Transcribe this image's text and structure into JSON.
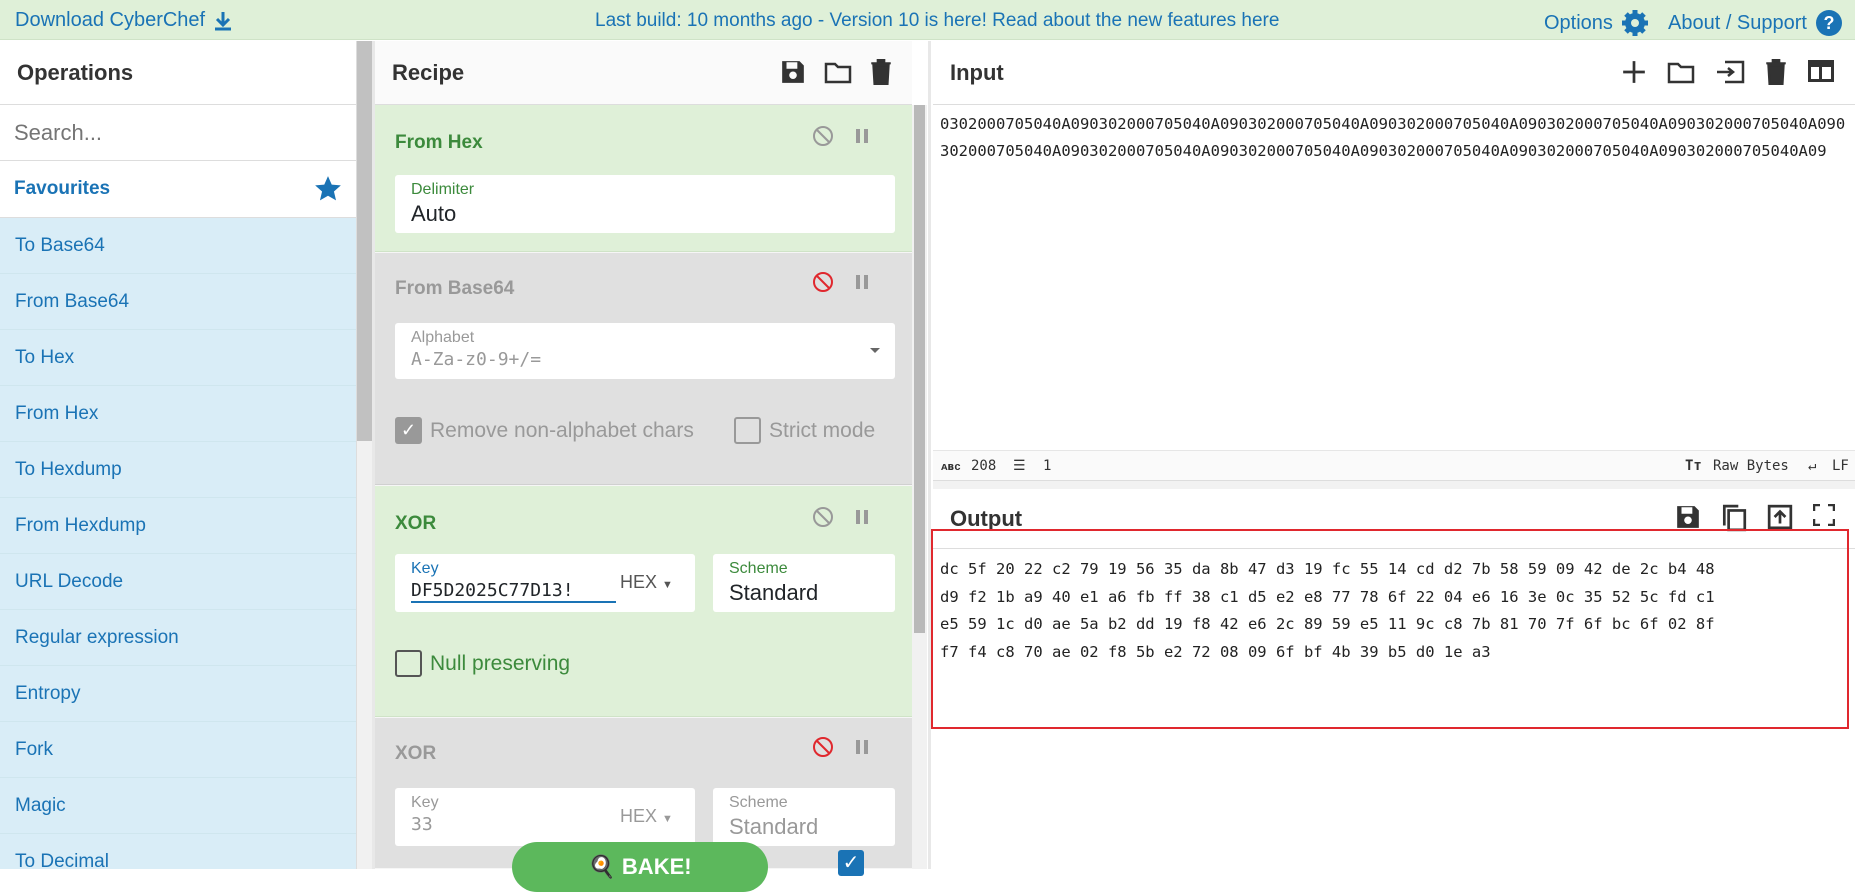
{
  "topbar": {
    "download_label": "Download CyberChef",
    "banner": "Last build: 10 months ago - Version 10 is here! Read about the new features here",
    "options_label": "Options",
    "about_label": "About / Support"
  },
  "operations": {
    "title": "Operations",
    "search_placeholder": "Search...",
    "favourites_label": "Favourites",
    "items": [
      "To Base64",
      "From Base64",
      "To Hex",
      "From Hex",
      "To Hexdump",
      "From Hexdump",
      "URL Decode",
      "Regular expression",
      "Entropy",
      "Fork",
      "Magic",
      "To Decimal"
    ]
  },
  "recipe": {
    "title": "Recipe",
    "ops": [
      {
        "name": "From Hex",
        "field_label": "Delimiter",
        "field_value": "Auto"
      },
      {
        "name": "From Base64",
        "field_label": "Alphabet",
        "field_value": "A-Za-z0-9+/=",
        "check1": "Remove non-alphabet chars",
        "check2": "Strict mode"
      },
      {
        "name": "XOR",
        "key_label": "Key",
        "key_value": "DF5D2025C77D13!",
        "key_type": "HEX",
        "scheme_label": "Scheme",
        "scheme_value": "Standard",
        "check1": "Null preserving"
      },
      {
        "name": "XOR",
        "key_label": "Key",
        "key_value": "33",
        "key_type": "HEX",
        "scheme_label": "Scheme",
        "scheme_value": "Standard"
      }
    ],
    "bake_label": "BAKE!"
  },
  "input": {
    "title": "Input",
    "text": "0302000705040A090302000705040A090302000705040A090302000705040A090302000705040A090302000705040A090302000705040A090302000705040A090302000705040A090302000705040A090302000705040A090302000705040A09",
    "char_count": "208",
    "line_count": "1",
    "encoding": "Raw Bytes",
    "eol": "LF"
  },
  "output": {
    "title": "Output",
    "text": "dc 5f 20 22 c2 79 19 56 35 da 8b 47 d3 19 fc 55 14 cd d2 7b 58 59 09 42 de 2c b4 48\nd9 f2 1b a9 40 e1 a6 fb ff 38 c1 d5 e2 e8 77 78 6f 22 04 e6 16 3e 0c 35 52 5c fd c1\ne5 59 1c d0 ae 5a b2 dd 19 f8 42 e6 2c 89 59 e5 11 9c c8 7b 81 70 7f 6f bc 6f 02 8f\nf7 f4 c8 70 ae 02 f8 5b e2 72 08 09 6f bf 4b 39 b5 d0 1e a3"
  },
  "colors": {
    "accent": "#1a73b5",
    "enabled_op_bg": "#dff0d8",
    "disabled_op_bg": "#e0e0e0",
    "highlight": "#e0282e"
  }
}
